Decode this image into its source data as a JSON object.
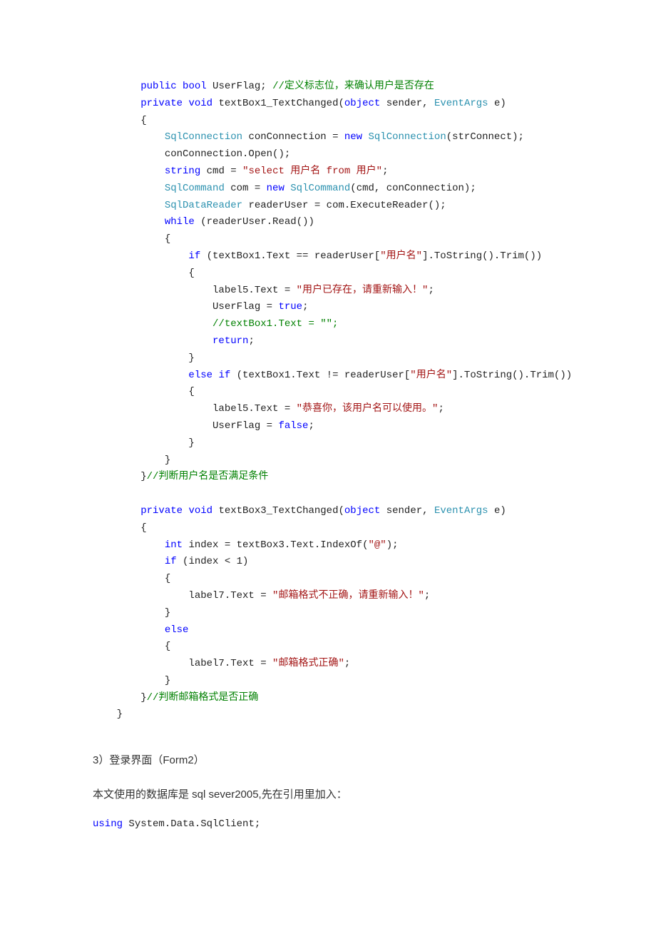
{
  "code1": {
    "l1_pre": "        ",
    "l1a": "public",
    "l1b": " ",
    "l1c": "bool",
    "l1d": " UserFlag; ",
    "l1e": "//定义标志位，来确认用户是否存在",
    "l2_pre": "        ",
    "l2a": "private",
    "l2b": " ",
    "l2c": "void",
    "l2d": " textBox1_TextChanged(",
    "l2e": "object",
    "l2f": " sender, ",
    "l2g": "EventArgs",
    "l2h": " e)",
    "l3": "        {",
    "l4_pre": "            ",
    "l4a": "SqlConnection",
    "l4b": " conConnection = ",
    "l4c": "new",
    "l4d": " ",
    "l4e": "SqlConnection",
    "l4f": "(strConnect);",
    "l5": "            conConnection.Open();",
    "l6_pre": "            ",
    "l6a": "string",
    "l6b": " cmd = ",
    "l6c": "\"select 用户名 from 用户\"",
    "l6d": ";",
    "l7_pre": "            ",
    "l7a": "SqlCommand",
    "l7b": " com = ",
    "l7c": "new",
    "l7d": " ",
    "l7e": "SqlCommand",
    "l7f": "(cmd, conConnection);",
    "l8_pre": "            ",
    "l8a": "SqlDataReader",
    "l8b": " readerUser = com.ExecuteReader();",
    "l9_pre": "            ",
    "l9a": "while",
    "l9b": " (readerUser.Read())",
    "l10": "            {",
    "l11_pre": "                ",
    "l11a": "if",
    "l11b": " (textBox1.Text == readerUser[",
    "l11c": "\"用户名\"",
    "l11d": "].ToString().Trim())",
    "l12": "                {",
    "l13_pre": "                    label5.Text = ",
    "l13a": "\"用户已存在，请重新输入！\"",
    "l13b": ";",
    "l14_pre": "                    UserFlag = ",
    "l14a": "true",
    "l14b": ";",
    "l15_pre": "                    ",
    "l15a": "//textBox1.Text = \"\";",
    "l16_pre": "                    ",
    "l16a": "return",
    "l16b": ";",
    "l17": "                }",
    "l18_pre": "                ",
    "l18a": "else",
    "l18b": " ",
    "l18c": "if",
    "l18d": " (textBox1.Text != readerUser[",
    "l18e": "\"用户名\"",
    "l18f": "].ToString().Trim())",
    "l19": "                {",
    "l20_pre": "                    label5.Text = ",
    "l20a": "\"恭喜你，该用户名可以使用。\"",
    "l20b": ";",
    "l21_pre": "                    UserFlag = ",
    "l21a": "false",
    "l21b": ";",
    "l22": "                }",
    "l23": "            }",
    "l24a": "        }",
    "l24b": "//判断用户名是否满足条件",
    "blank1": "",
    "l25_pre": "        ",
    "l25a": "private",
    "l25b": " ",
    "l25c": "void",
    "l25d": " textBox3_TextChanged(",
    "l25e": "object",
    "l25f": " sender, ",
    "l25g": "EventArgs",
    "l25h": " e)",
    "l26": "        {",
    "l27_pre": "            ",
    "l27a": "int",
    "l27b": " index = textBox3.Text.IndexOf(",
    "l27c": "\"@\"",
    "l27d": ");",
    "l28_pre": "            ",
    "l28a": "if",
    "l28b": " (index < 1)",
    "l29": "            {",
    "l30_pre": "                label7.Text = ",
    "l30a": "\"邮箱格式不正确，请重新输入！\"",
    "l30b": ";",
    "l31": "            }",
    "l32_pre": "            ",
    "l32a": "else",
    "l33": "            {",
    "l34_pre": "                label7.Text = ",
    "l34a": "\"邮箱格式正确\"",
    "l34b": ";",
    "l35": "            }",
    "l36a": "        }",
    "l36b": "//判断邮箱格式是否正确",
    "l37": "    }"
  },
  "section_title": "3）登录界面（Form2）",
  "paragraph1": "本文使用的数据库是 sql sever2005,先在引用里加入：",
  "using_line": {
    "a": "using",
    "b": " System.Data.SqlClient;"
  }
}
